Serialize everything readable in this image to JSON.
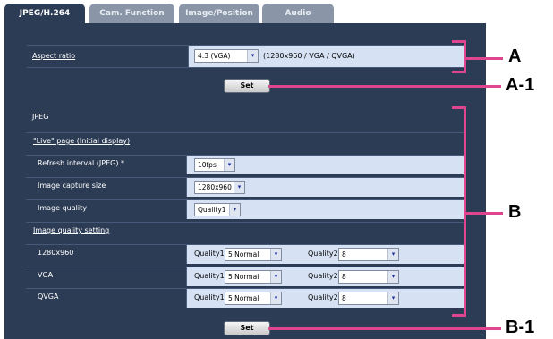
{
  "tabs": [
    {
      "label": "JPEG/H.264",
      "active": true
    },
    {
      "label": "Cam. Function",
      "active": false
    },
    {
      "label": "Image/Position",
      "active": false
    },
    {
      "label": "Audio",
      "active": false
    }
  ],
  "aspect": {
    "label": "Aspect ratio",
    "value": "4:3 (VGA)",
    "note": "(1280x960 / VGA / QVGA)"
  },
  "set_a_label": "Set",
  "jpeg": {
    "heading": "JPEG",
    "live_page": "\"Live\" page (Initial display)",
    "refresh_label": "Refresh interval (JPEG) *",
    "refresh_value": "10fps",
    "capture_label": "Image capture size",
    "capture_value": "1280x960",
    "quality_label": "Image quality",
    "quality_value": "Quality1",
    "quality_setting": "Image quality setting",
    "rows": [
      {
        "label": "1280x960",
        "q1_label": "Quality1",
        "q1_value": "5 Normal",
        "q2_label": "Quality2",
        "q2_value": "8"
      },
      {
        "label": "VGA",
        "q1_label": "Quality1",
        "q1_value": "5 Normal",
        "q2_label": "Quality2",
        "q2_value": "8"
      },
      {
        "label": "QVGA",
        "q1_label": "Quality1",
        "q1_value": "5 Normal",
        "q2_label": "Quality2",
        "q2_value": "8"
      }
    ]
  },
  "set_b_label": "Set",
  "callouts": {
    "a": "A",
    "a1": "A-1",
    "b": "B",
    "b1": "B-1"
  },
  "colors": {
    "panel": "#2c3c55",
    "cell": "#d6e2f3",
    "callout": "#e0458f"
  }
}
